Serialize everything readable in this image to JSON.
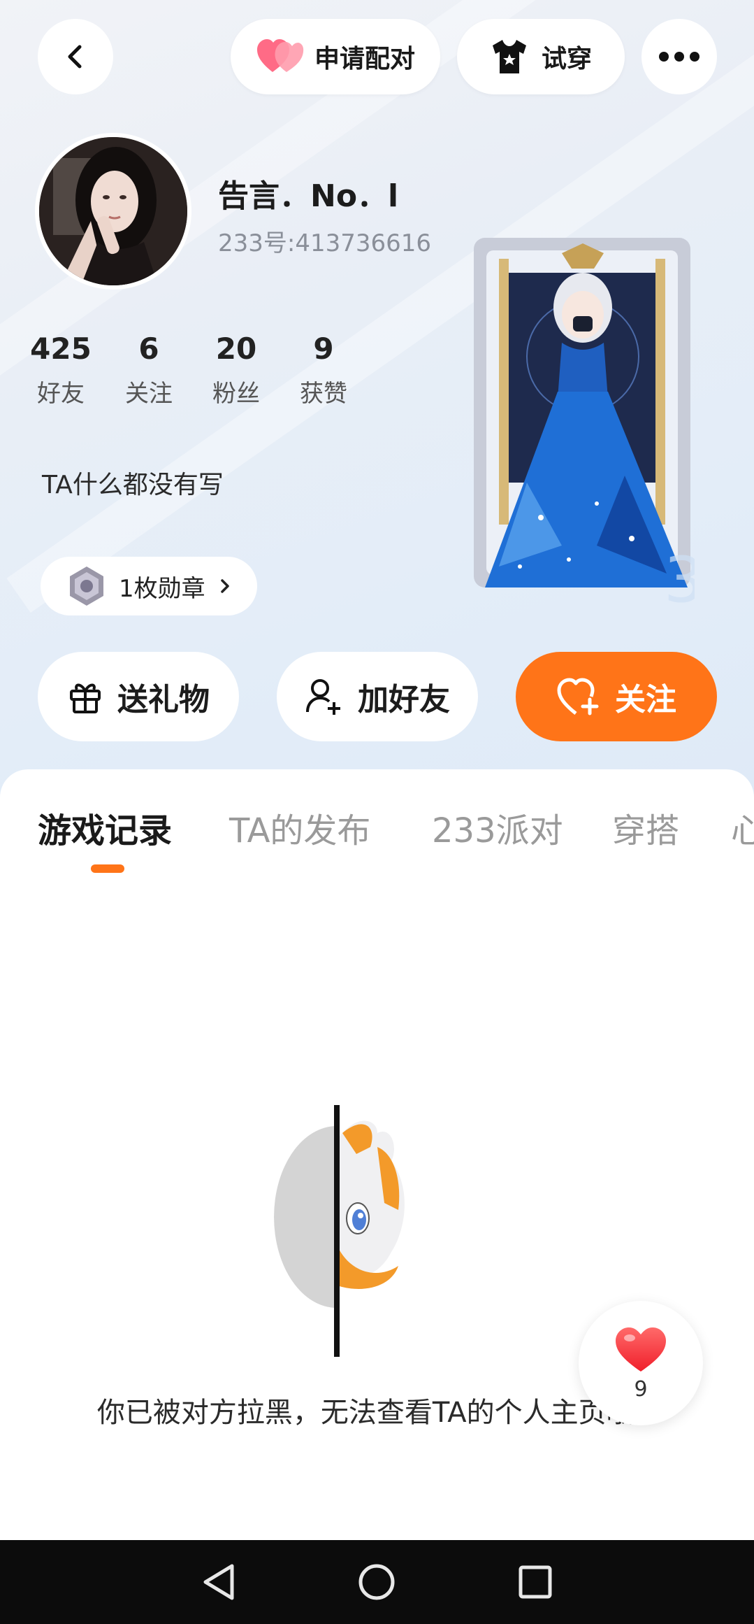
{
  "header": {
    "match_label": "申请配对",
    "tryon_label": "试穿"
  },
  "profile": {
    "username": "告言．No．l",
    "user_id": "233号:413736616",
    "stats": [
      {
        "value": "425",
        "label": "好友"
      },
      {
        "value": "6",
        "label": "关注"
      },
      {
        "value": "20",
        "label": "粉丝"
      },
      {
        "value": "9",
        "label": "获赞"
      }
    ],
    "bio": "TA什么都没有写",
    "medal_label": "1枚勋章"
  },
  "actions": {
    "gift_label": "送礼物",
    "add_friend_label": "加好友",
    "follow_label": "关注"
  },
  "tabs": [
    {
      "label": "游戏记录",
      "active": true
    },
    {
      "label": "TA的发布",
      "active": false
    },
    {
      "label": "233派对",
      "active": false
    },
    {
      "label": "穿搭",
      "active": false
    },
    {
      "label": "心",
      "active": false
    }
  ],
  "empty_state": {
    "message": "你已被对方拉黑，无法查看TA的个人主页哦~"
  },
  "floating_like": {
    "count": "9"
  },
  "colors": {
    "accent": "#ff7418",
    "heart": "#ff3b3b"
  }
}
